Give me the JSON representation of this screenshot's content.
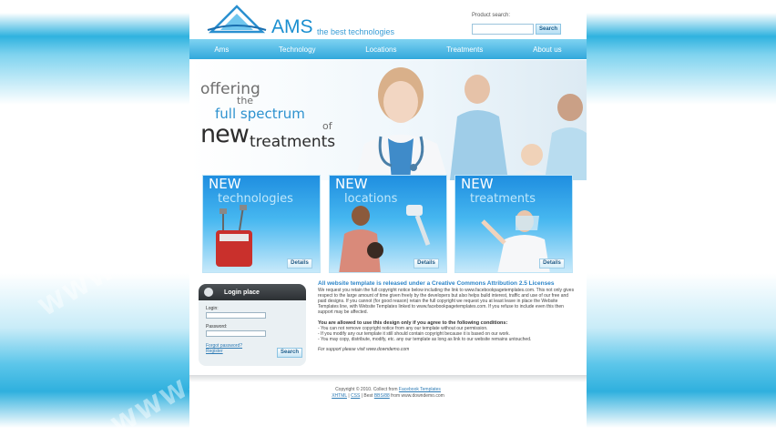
{
  "header": {
    "logo_text": "AMS",
    "tagline": "the best technologies",
    "search_label": "Product search:",
    "search_value": "",
    "search_button": "Search"
  },
  "nav": [
    "Ams",
    "Technology",
    "Locations",
    "Treatments",
    "About us"
  ],
  "hero": {
    "line1": "offering",
    "line2": "the",
    "line3": "full spectrum",
    "line4": "of",
    "line5": "new",
    "line6": "treatments"
  },
  "cards": [
    {
      "new": "NEW",
      "title": "technologies",
      "button": "Details"
    },
    {
      "new": "NEW",
      "title": "locations",
      "button": "Details"
    },
    {
      "new": "NEW",
      "title": "treatments",
      "button": "Details"
    }
  ],
  "login": {
    "title": "Login place",
    "login_label": "Login:",
    "password_label": "Password:",
    "forgot": "Forgot password?",
    "register": "Register",
    "button": "Search"
  },
  "content": {
    "title": "All website template is released under a Creative Commons Attribution 2.5 Licenses",
    "para1": "We request you retain the full copyright notice below including the link to www.facebookpagetemplates.com. This not only gives respect to the large amount of time given freely by the developers but also helps build interest, traffic and use of our free and paid designs. If you cannot (for good reason) retain the full copyright we request you at least leave in place the Website Templates line, with Website Templates linked to www.facebookpagetemplates.com. If you refuse to include even this then support may be affected.",
    "section": "You are allowed to use this design only if you agree to the following conditions:",
    "items": [
      "- You can not remove copyright notice from any our template without our permission.",
      "- If you modify any our template it still should contain copyright because it is based on our work.",
      "- You may copy, distribute, modify, etc. any our template as long as link to our website remains untouched."
    ],
    "support": "For support please visit www.downdemo.com"
  },
  "footer": {
    "line1_prefix": "Copyright © 2010. Collect from",
    "line1_link": "Facebook Templates",
    "line2_a": "XHTML",
    "line2_sep": "|",
    "line2_b": "CSS",
    "line2_mid": "| Best",
    "line2_c": "BBS/88",
    "line2_end": "from www.downdemo.com"
  },
  "watermark": "WWW.DOWNDEMO.COM",
  "colors": {
    "accent": "#2e92cf",
    "nav": "#31a8dc",
    "login_head": "#3a3f43"
  }
}
